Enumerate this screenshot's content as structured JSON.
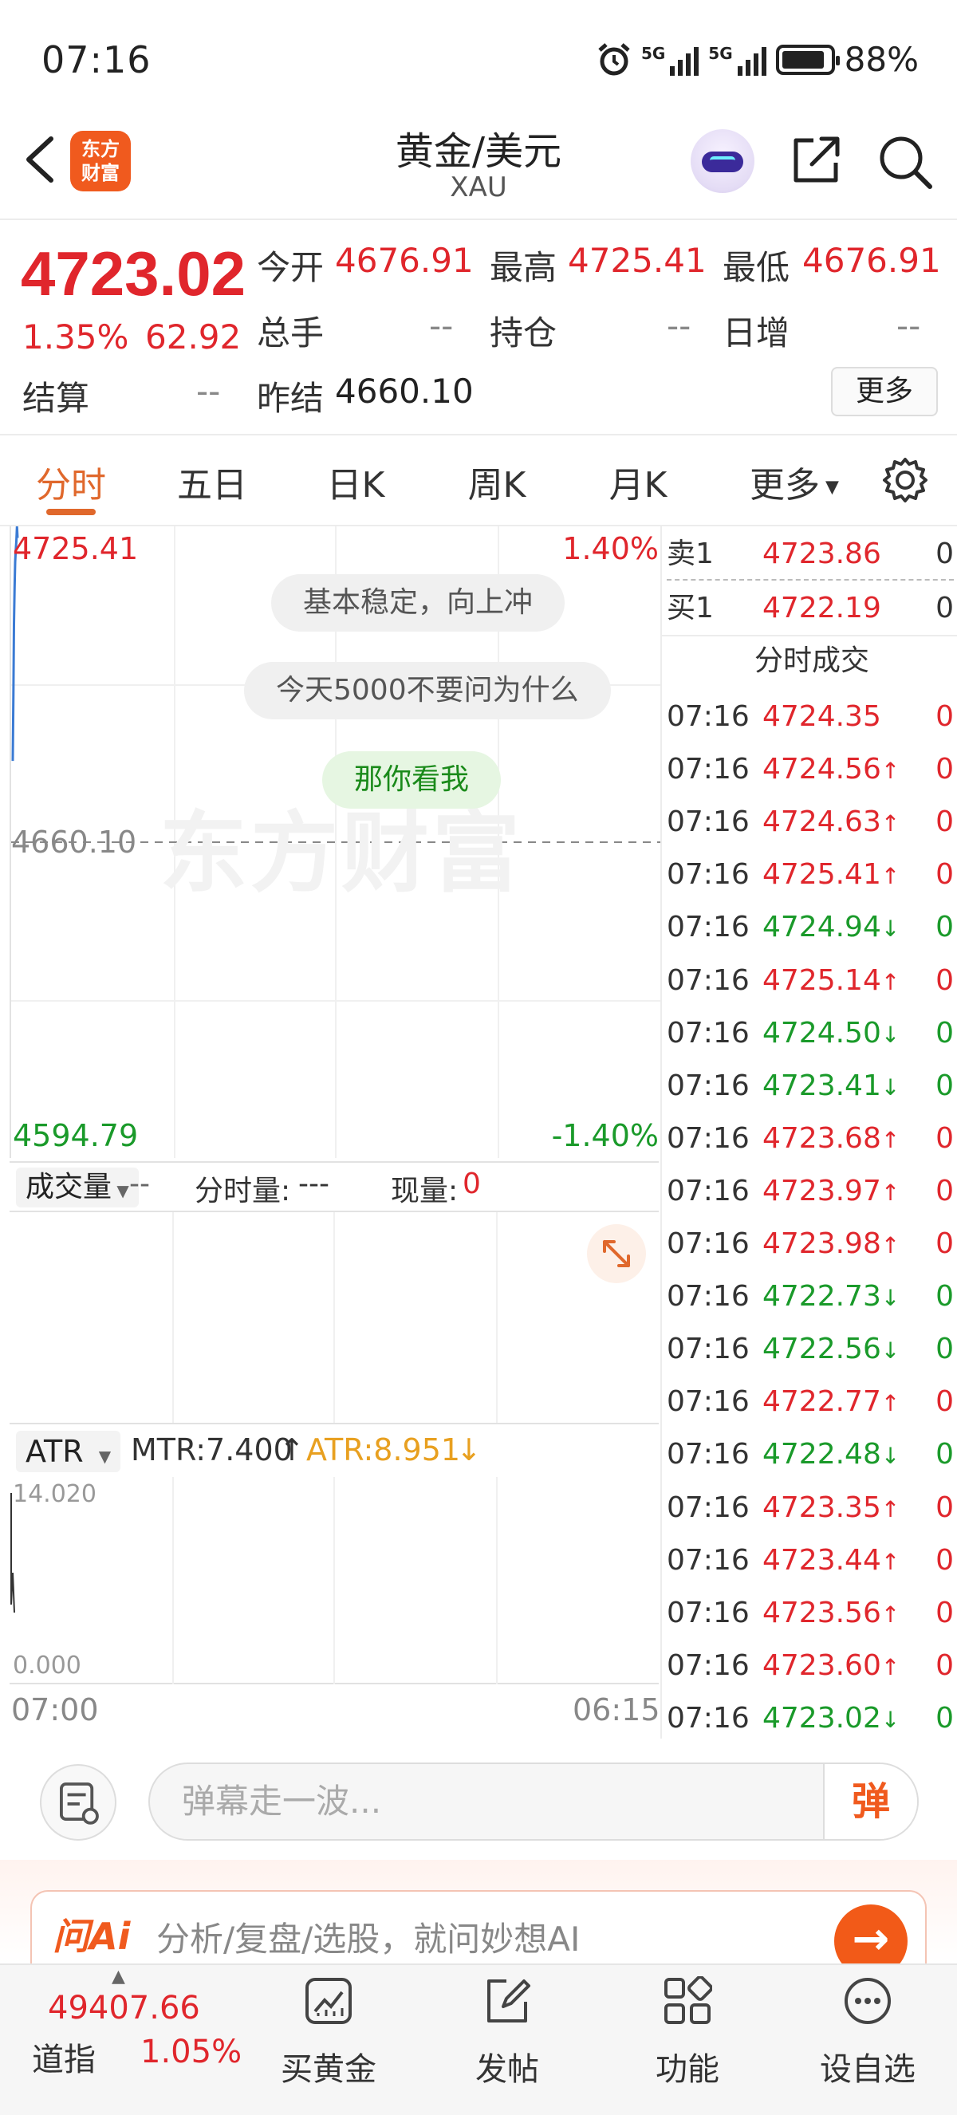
{
  "status_bar": {
    "time": "07:16",
    "network1": "5G",
    "network2": "5G",
    "battery": "88%"
  },
  "header": {
    "title": "黄金/美元",
    "subtitle": "XAU",
    "logo_text": "东方财富"
  },
  "quote": {
    "price": "4723.02",
    "change_pct": "1.35%",
    "change": "62.92",
    "fields": [
      {
        "label": "今开",
        "value": "4676.91",
        "color": "red"
      },
      {
        "label": "最高",
        "value": "4725.41",
        "color": "red"
      },
      {
        "label": "最低",
        "value": "4676.91",
        "color": "red"
      },
      {
        "label": "总手",
        "value": "--",
        "color": "gray"
      },
      {
        "label": "持仓",
        "value": "--",
        "color": "gray"
      },
      {
        "label": "日增",
        "value": "--",
        "color": "gray"
      },
      {
        "label": "结算",
        "value": "--",
        "color": "gray"
      },
      {
        "label": "昨结",
        "value": "4660.10",
        "color": "dark"
      }
    ],
    "more_label": "更多"
  },
  "tabs": [
    "分时",
    "五日",
    "日K",
    "周K",
    "月K",
    "更多"
  ],
  "chart": {
    "high_label": "4725.41",
    "high_pct": "1.40%",
    "prev_settle": "4660.10",
    "low_label": "4594.79",
    "low_pct": "-1.40%",
    "watermark": "东方财富",
    "danmu": [
      "基本稳定，向上冲",
      "今天5000不要问为什么",
      "那你看我"
    ],
    "price_series": [
      4676.91,
      4690.5,
      4705.2,
      4712.8,
      4718.0,
      4720.6,
      4722.3,
      4725.41,
      4723.02
    ],
    "y_range": [
      4594.79,
      4725.41
    ]
  },
  "volume": {
    "selector": "成交量",
    "value": "--",
    "fenshi_label": "分时量:",
    "fenshi_value": "---",
    "now_label": "现量:",
    "now_value": "0"
  },
  "atr": {
    "selector": "ATR",
    "mtr": "MTR:7.400",
    "mtr_arrow": "↑",
    "atr_value": "ATR:8.951",
    "atr_arrow": "↓",
    "y_max": "14.020",
    "y_min": "0.000",
    "x_start": "07:00",
    "x_end": "06:15",
    "atr_color": "#e8a020"
  },
  "orderbook": {
    "sell": {
      "label": "卖1",
      "price": "4723.86",
      "vol": "0"
    },
    "buy": {
      "label": "买1",
      "price": "4722.19",
      "vol": "0"
    },
    "trades_title": "分时成交",
    "trades": [
      {
        "time": "07:16",
        "price": "4724.35",
        "dir": "",
        "vol": "0",
        "color": "red"
      },
      {
        "time": "07:16",
        "price": "4724.56",
        "dir": "↑",
        "vol": "0",
        "color": "red"
      },
      {
        "time": "07:16",
        "price": "4724.63",
        "dir": "↑",
        "vol": "0",
        "color": "red"
      },
      {
        "time": "07:16",
        "price": "4725.41",
        "dir": "↑",
        "vol": "0",
        "color": "red"
      },
      {
        "time": "07:16",
        "price": "4724.94",
        "dir": "↓",
        "vol": "0",
        "color": "green"
      },
      {
        "time": "07:16",
        "price": "4725.14",
        "dir": "↑",
        "vol": "0",
        "color": "red"
      },
      {
        "time": "07:16",
        "price": "4724.50",
        "dir": "↓",
        "vol": "0",
        "color": "green"
      },
      {
        "time": "07:16",
        "price": "4723.41",
        "dir": "↓",
        "vol": "0",
        "color": "green"
      },
      {
        "time": "07:16",
        "price": "4723.68",
        "dir": "↑",
        "vol": "0",
        "color": "red"
      },
      {
        "time": "07:16",
        "price": "4723.97",
        "dir": "↑",
        "vol": "0",
        "color": "red"
      },
      {
        "time": "07:16",
        "price": "4723.98",
        "dir": "↑",
        "vol": "0",
        "color": "red"
      },
      {
        "time": "07:16",
        "price": "4722.73",
        "dir": "↓",
        "vol": "0",
        "color": "green"
      },
      {
        "time": "07:16",
        "price": "4722.56",
        "dir": "↓",
        "vol": "0",
        "color": "green"
      },
      {
        "time": "07:16",
        "price": "4722.77",
        "dir": "↑",
        "vol": "0",
        "color": "red"
      },
      {
        "time": "07:16",
        "price": "4722.48",
        "dir": "↓",
        "vol": "0",
        "color": "green"
      },
      {
        "time": "07:16",
        "price": "4723.35",
        "dir": "↑",
        "vol": "0",
        "color": "red"
      },
      {
        "time": "07:16",
        "price": "4723.44",
        "dir": "↑",
        "vol": "0",
        "color": "red"
      },
      {
        "time": "07:16",
        "price": "4723.56",
        "dir": "↑",
        "vol": "0",
        "color": "red"
      },
      {
        "time": "07:16",
        "price": "4723.60",
        "dir": "↑",
        "vol": "0",
        "color": "red"
      },
      {
        "time": "07:16",
        "price": "4723.02",
        "dir": "↓",
        "vol": "0",
        "color": "green"
      }
    ]
  },
  "danmu_input": {
    "placeholder": "弹幕走一波...",
    "send_label": "弹"
  },
  "ai_bar": {
    "logo": "问Ai",
    "text": "分析/复盘/选股，就问妙想AI"
  },
  "bottom_nav": {
    "index_value": "49407.66",
    "index_name": "道指",
    "index_pct": "1.05%",
    "items": [
      "买黄金",
      "发帖",
      "功能",
      "设自选"
    ]
  },
  "colors": {
    "up": "#e0262c",
    "down": "#1a9a2a",
    "accent": "#f05a1e",
    "line": "#3b7bd4"
  }
}
